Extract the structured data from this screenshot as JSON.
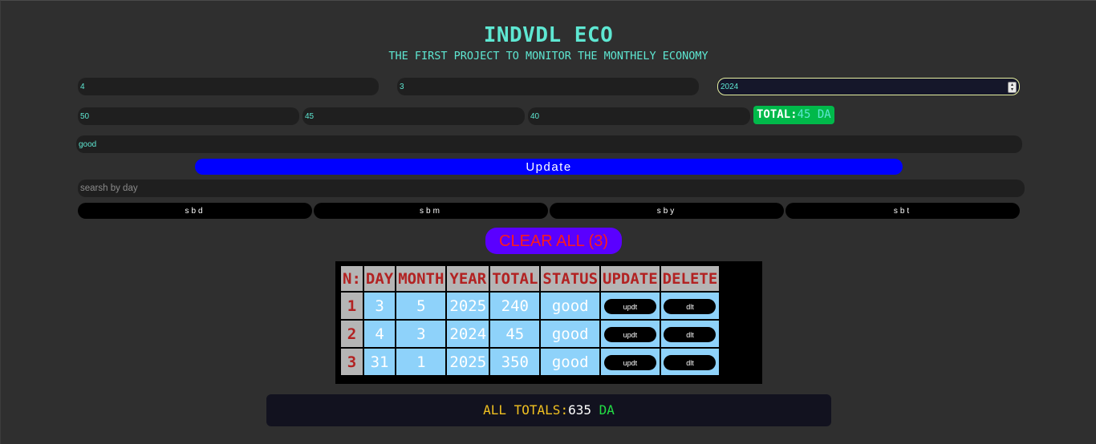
{
  "header": {
    "title": "INDVDL ECO",
    "subtitle": "THE FIRST PROJECT TO MONITOR THE MONTHELY ECONOMY"
  },
  "form": {
    "day": "4",
    "month": "3",
    "year": "2024",
    "price1": "50",
    "price2": "45",
    "price3": "40",
    "status": "good"
  },
  "total_badge": {
    "label": "TOTAL:",
    "value": "45",
    "unit": "DA"
  },
  "update_button": "Update",
  "search": {
    "placeholder": "searsh by day"
  },
  "search_buttons": [
    "sbd",
    "sbm",
    "sby",
    "sbt"
  ],
  "clear_all": "CLEAR ALL (3)",
  "table": {
    "headers": [
      "N:",
      "DAY",
      "MONTH",
      "YEAR",
      "TOTAL",
      "STATUS",
      "UPDATE",
      "DELETE"
    ],
    "rows": [
      {
        "n": "1",
        "day": "3",
        "month": "5",
        "year": "2025",
        "total": "240",
        "status": "good",
        "update": "updt",
        "delete": "dlt"
      },
      {
        "n": "2",
        "day": "4",
        "month": "3",
        "year": "2024",
        "total": "45",
        "status": "good",
        "update": "updt",
        "delete": "dlt"
      },
      {
        "n": "3",
        "day": "31",
        "month": "1",
        "year": "2025",
        "total": "350",
        "status": "good",
        "update": "updt",
        "delete": "dlt"
      }
    ]
  },
  "all_totals": {
    "label": "ALL TOTALS:",
    "value": "635",
    "unit": "DA"
  },
  "colors": {
    "accent": "#5ee7d2",
    "update_button": "#0000ff",
    "clear_button": "#5a00ff",
    "total_badge": "#00b94a",
    "table_cell": "#8ed2fa",
    "table_header_text": "#b22222"
  }
}
